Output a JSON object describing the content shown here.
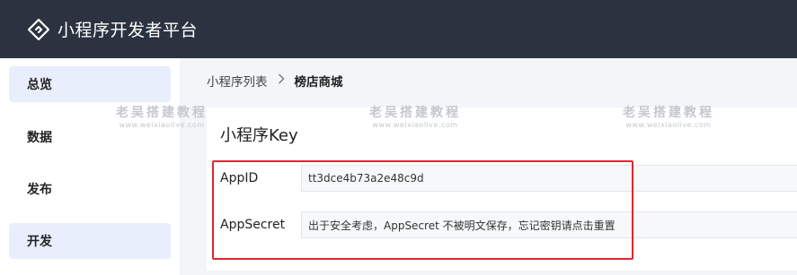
{
  "header": {
    "title": "小程序开发者平台",
    "logo_icon": "dev-platform-logo-icon"
  },
  "sidebar": {
    "items": [
      {
        "label": "总览",
        "active": true
      },
      {
        "label": "数据",
        "active": false
      },
      {
        "label": "发布",
        "active": false
      },
      {
        "label": "开发",
        "active": true
      }
    ]
  },
  "breadcrumb": {
    "parent": "小程序列表",
    "separator_icon": "chevron-right-icon",
    "current": "榜店商城"
  },
  "watermark": {
    "title": "老吴搭建教程",
    "url": "www.weixiaolive.com"
  },
  "key_card": {
    "title": "小程序Key",
    "app_id": {
      "label": "AppID",
      "value": "tt3dce4b73a2e48c9d"
    },
    "app_secret": {
      "label": "AppSecret",
      "value": "出于安全考虑，AppSecret 不被明文保存，忘记密钥请点击重置"
    }
  },
  "colors": {
    "topbar": "#2b3340",
    "highlight": "#e0272e",
    "active_bg": "#e8eefb"
  }
}
